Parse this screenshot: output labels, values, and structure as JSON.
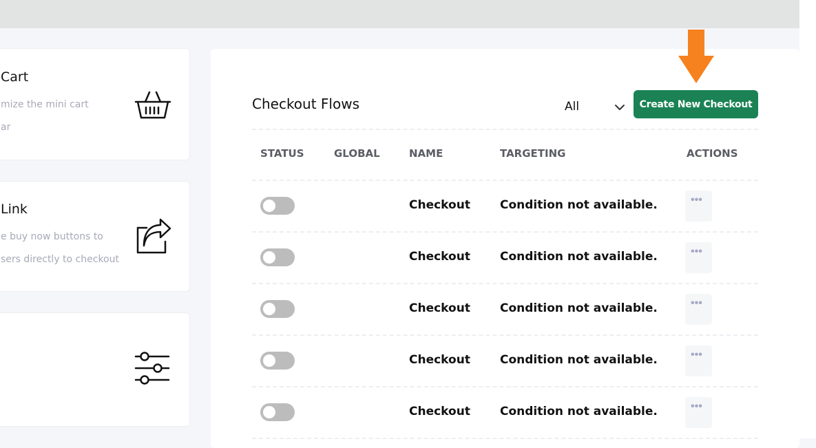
{
  "cards": [
    {
      "title": "Cart",
      "desc_lines": [
        "mize the mini cart",
        "ar"
      ],
      "icon": "basket-icon"
    },
    {
      "title": "Link",
      "desc_lines": [
        "e buy now buttons to",
        "sers directly to checkout"
      ],
      "icon": "share-icon"
    },
    {
      "title": "",
      "desc_lines": [],
      "icon": "sliders-icon"
    }
  ],
  "panel": {
    "title": "Checkout Flows",
    "filter": {
      "selected": "All"
    },
    "create_button": "Create New Checkout",
    "columns": [
      "STATUS",
      "GLOBAL",
      "NAME",
      "TARGETING",
      "ACTIONS"
    ],
    "rows": [
      {
        "status": "off",
        "global": "",
        "name": "Checkout",
        "targeting": "Condition not available.",
        "actions": "•••"
      },
      {
        "status": "off",
        "global": "",
        "name": "Checkout",
        "targeting": "Condition not available.",
        "actions": "•••"
      },
      {
        "status": "off",
        "global": "",
        "name": "Checkout",
        "targeting": "Condition not available.",
        "actions": "•••"
      },
      {
        "status": "off",
        "global": "",
        "name": "Checkout",
        "targeting": "Condition not available.",
        "actions": "•••"
      },
      {
        "status": "off",
        "global": "",
        "name": "Checkout",
        "targeting": "Condition not available.",
        "actions": "•••"
      }
    ]
  },
  "colors": {
    "accent": "#1a8254",
    "arrow": "#f6821f",
    "toggle_off": "#bcbcbc"
  }
}
